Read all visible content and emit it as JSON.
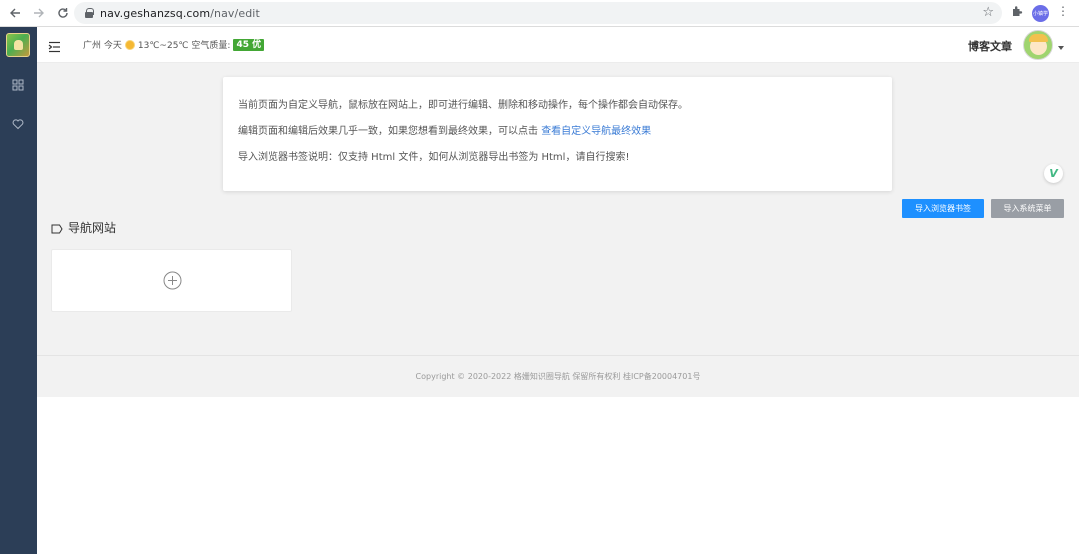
{
  "browser": {
    "url_host": "nav.geshanzsq.com",
    "url_path": "/nav/edit",
    "profile_label": "小镇学"
  },
  "header": {
    "weather_city": "广州 今天",
    "weather_temp": "13℃~25℃ 空气质量:",
    "aqi": "45 优",
    "blog_link": "博客文章"
  },
  "info": {
    "line1": "当前页面为自定义导航，鼠标放在网站上，即可进行编辑、删除和移动操作，每个操作都会自动保存。",
    "line2_prefix": "编辑页面和编辑后效果几乎一致，如果您想看到最终效果，可以点击 ",
    "line2_link": "查看自定义导航最终效果",
    "line3": "导入浏览器书签说明：仅支持 Html 文件，如何从浏览器导出书签为 Html，请自行搜索!"
  },
  "actions": {
    "import_bookmarks": "导入浏览器书签",
    "import_system_menu": "导入系统菜单"
  },
  "section": {
    "title": "导航网站"
  },
  "badge": {
    "letter": "V"
  },
  "footer": {
    "copyright": "Copyright © 2020-2022 格姗知识圈导航 保留所有权利 桂ICP备20004701号"
  },
  "colors": {
    "sidebar": "#2c3e57",
    "primary": "#1e90ff",
    "secondary": "#999ea5",
    "aqi": "#43a735",
    "link": "#3a7bd5"
  }
}
